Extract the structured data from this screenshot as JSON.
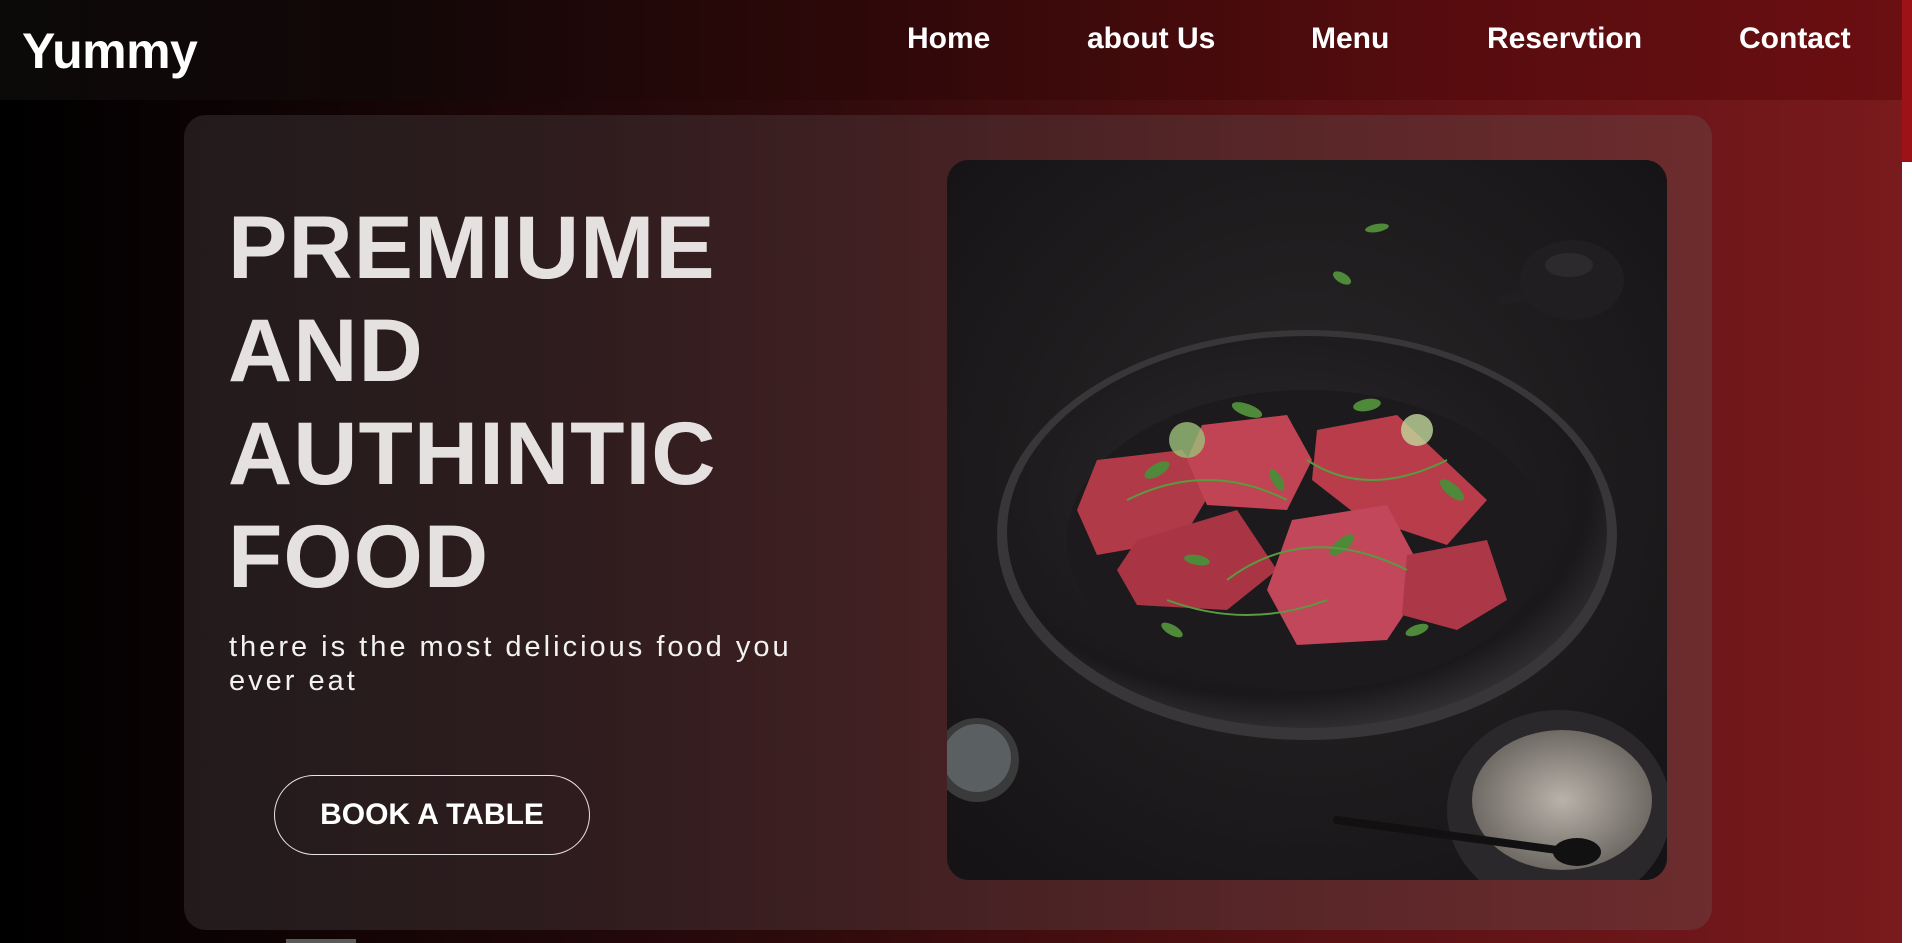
{
  "header": {
    "logo": "Yummy",
    "nav": [
      {
        "label": "Home"
      },
      {
        "label": "about Us"
      },
      {
        "label": "Menu"
      },
      {
        "label": "Reservtion"
      },
      {
        "label": "Contact"
      }
    ]
  },
  "hero": {
    "headline_lines": [
      "PREMIUME",
      "AND",
      "AUTHINTIC",
      "FOOD"
    ],
    "subtext": "there is the most delicious food you ever eat",
    "cta_label": "BOOK A TABLE",
    "image_subject": "plate-of-raw-meat-with-herbs"
  },
  "colors": {
    "accent_red": "#9c1216",
    "text_light": "#e6e1e1"
  }
}
